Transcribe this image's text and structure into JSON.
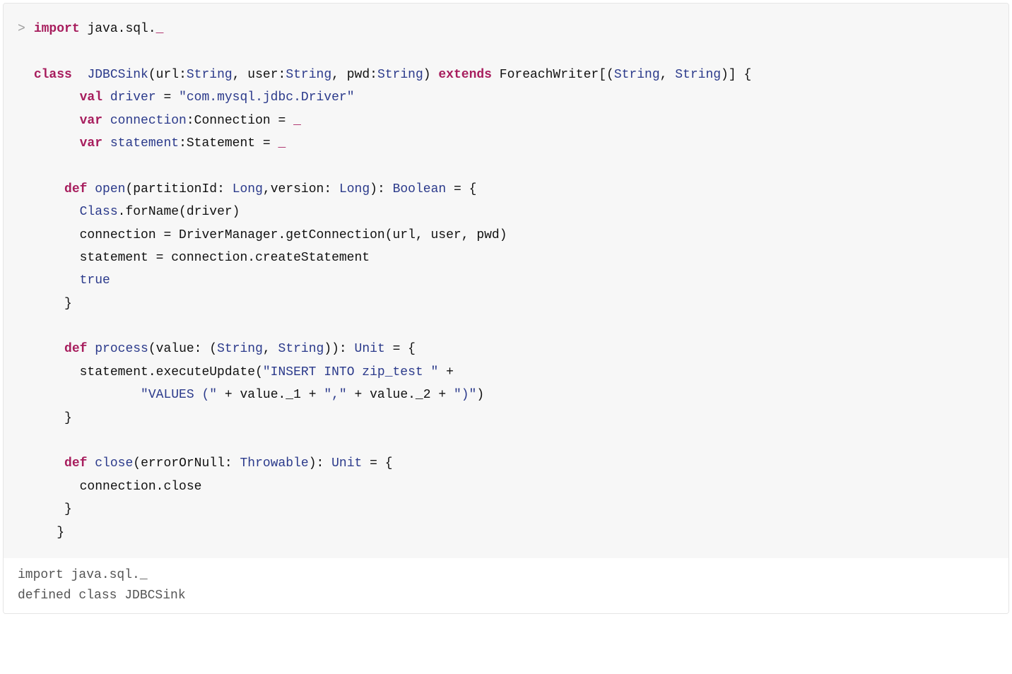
{
  "prompt_symbol": ">",
  "code": {
    "l1": {
      "kw1": "import",
      "pkg1": "java.sql.",
      "und1": "_"
    },
    "l2": "",
    "l3": {
      "kw_class": "class",
      "sp1": "  ",
      "cls_name": "JDBCSink",
      "open_p": "(url:",
      "t1": "String",
      "c1": ", user:",
      "t2": "String",
      "c2": ", pwd:",
      "t3": "String",
      "close_p": ") ",
      "kw_ext": "extends",
      "sp2": " ForeachWriter[(",
      "t4": "String",
      "c3": ", ",
      "t5": "String",
      "c4": ")] {"
    },
    "l4": {
      "indent": "      ",
      "kw": "val",
      "sp": " ",
      "name": "driver",
      "eq": " = ",
      "str": "\"com.mysql.jdbc.Driver\""
    },
    "l5": {
      "indent": "      ",
      "kw": "var",
      "sp": " ",
      "name": "connection",
      "colon": ":Connection = ",
      "und": "_"
    },
    "l6": {
      "indent": "      ",
      "kw": "var",
      "sp": " ",
      "name": "statement",
      "colon": ":Statement = ",
      "und": "_"
    },
    "l7": "    ",
    "l8": {
      "indent": "    ",
      "kw": "def",
      "sp": " ",
      "name": "open",
      "sig1": "(partitionId: ",
      "t1": "Long",
      "sig2": ",version: ",
      "t2": "Long",
      "sig3": "): ",
      "ret": "Boolean",
      "sig4": " = {"
    },
    "l9": {
      "indent": "      ",
      "cls": "Class",
      "rest": ".forName(driver)"
    },
    "l10": {
      "indent": "      ",
      "txt": "connection = DriverManager.getConnection(url, user, pwd)"
    },
    "l11": {
      "indent": "      ",
      "txt": "statement = connection.createStatement"
    },
    "l12": {
      "indent": "      ",
      "lit": "true"
    },
    "l13": {
      "indent": "    ",
      "txt": "}"
    },
    "l14": "",
    "l15": {
      "indent": "    ",
      "kw": "def",
      "sp": " ",
      "name": "process",
      "sig1": "(value: (",
      "t1": "String",
      "sig2": ", ",
      "t2": "String",
      "sig3": ")): ",
      "ret": "Unit",
      "sig4": " = {"
    },
    "l16": {
      "indent": "      ",
      "pre": "statement.executeUpdate(",
      "s1": "\"INSERT INTO zip_test \"",
      "plus": " +"
    },
    "l17": {
      "indent": "              ",
      "s1": "\"VALUES (\"",
      "p1": " + value._1 + ",
      "s2": "\",\"",
      "p2": " + value._2 + ",
      "s3": "\")\"",
      "p3": ")"
    },
    "l18": {
      "indent": "    ",
      "txt": "}"
    },
    "l19": "",
    "l20": {
      "indent": "    ",
      "kw": "def",
      "sp": " ",
      "name": "close",
      "sig1": "(errorOrNull: ",
      "t1": "Throwable",
      "sig2": "): ",
      "ret": "Unit",
      "sig3": " = {"
    },
    "l21": {
      "indent": "      ",
      "txt": "connection.close"
    },
    "l22": {
      "indent": "    ",
      "txt": "}"
    },
    "l23": {
      "indent": "   ",
      "txt": "}"
    }
  },
  "output": {
    "line1": "import java.sql._",
    "line2": "defined class JDBCSink"
  }
}
